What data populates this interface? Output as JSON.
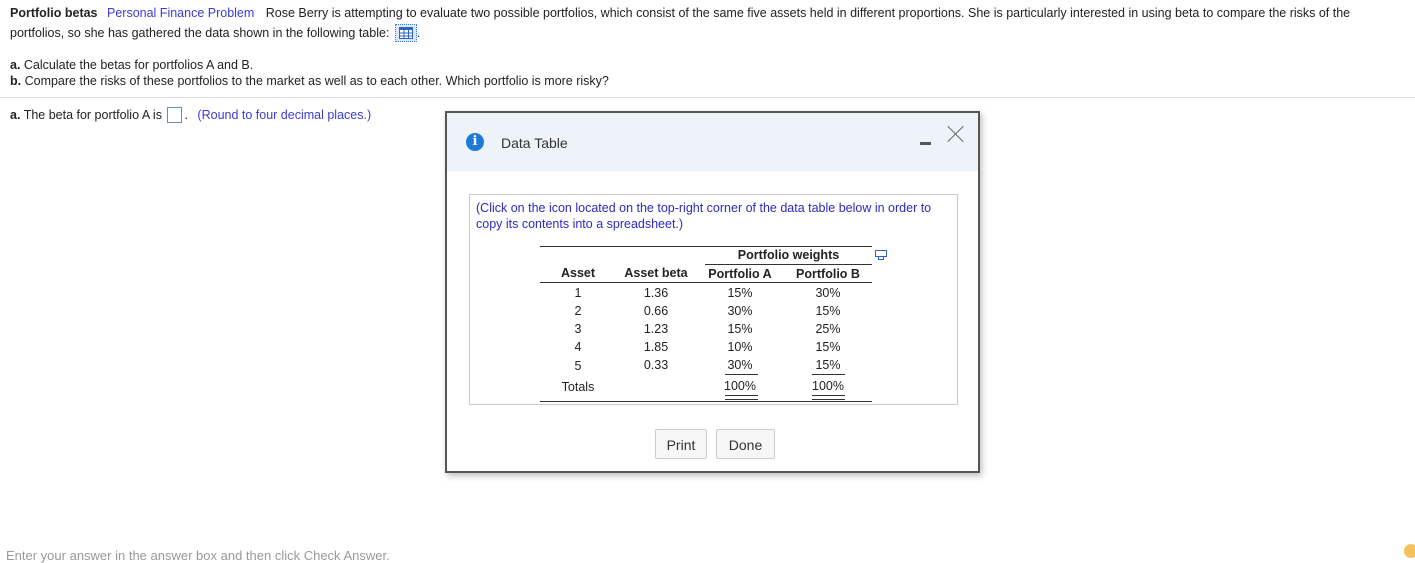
{
  "problem": {
    "title": "Portfolio betas",
    "tag": "Personal Finance Problem",
    "text_line1": "Rose Berry is attempting to evaluate two possible portfolios, which consist of the same five assets held in different proportions.  She is particularly interested in using beta to compare the risks of the",
    "text_line2": "portfolios, so she has gathered the data shown in the following table:",
    "table_icon": "table-grid-icon"
  },
  "parts": {
    "a_label": "a.",
    "a_text": "Calculate the betas for portfolios A and B.",
    "b_label": "b.",
    "b_text": "Compare the risks of these portfolios to the market as well as to each other.  Which portfolio is more risky?"
  },
  "answer": {
    "label": "a.",
    "text": "The beta for portfolio A is",
    "value": "",
    "suffix": ".",
    "note": "(Round to four decimal places.)"
  },
  "footer": {
    "text": "Enter your answer in the answer box and then click Check Answer."
  },
  "dialog": {
    "title": "Data Table",
    "info_icon": "info-icon",
    "instructions": "(Click on the icon located on the top-right corner of the data table below in order to copy its contents into a spreadsheet.)",
    "table": {
      "group_header": "Portfolio weights",
      "columns": [
        "Asset",
        "Asset beta",
        "Portfolio A",
        "Portfolio B"
      ],
      "rows": [
        [
          "1",
          "1.36",
          "15%",
          "30%"
        ],
        [
          "2",
          "0.66",
          "30%",
          "15%"
        ],
        [
          "3",
          "1.23",
          "15%",
          "25%"
        ],
        [
          "4",
          "1.85",
          "10%",
          "15%"
        ],
        [
          "5",
          "0.33",
          "30%",
          "15%"
        ]
      ],
      "totals_label": "Totals",
      "totals": [
        "100%",
        "100%"
      ]
    },
    "buttons": {
      "print": "Print",
      "done": "Done"
    }
  }
}
